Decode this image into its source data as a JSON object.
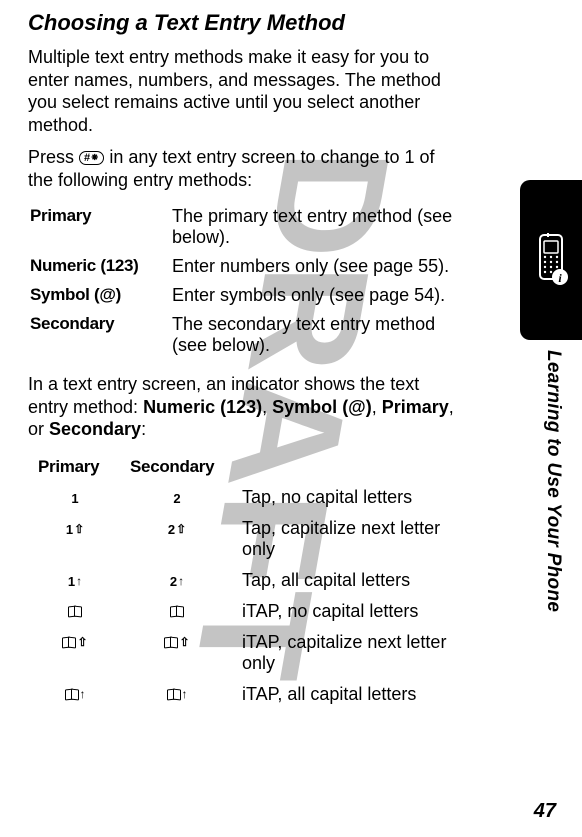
{
  "title": "Choosing a Text Entry Method",
  "intro": "Multiple text entry methods make it easy for you to enter names, numbers, and messages. The method you select remains active until you select another method.",
  "press_pre": "Press ",
  "press_key": "#⁕",
  "press_post": " in any text entry screen to change to 1 of the following entry methods:",
  "methods": [
    {
      "label": "Primary",
      "desc": "The primary text entry method (see below)."
    },
    {
      "label": "Numeric (123)",
      "desc": "Enter numbers only (see page 55)."
    },
    {
      "label": "Symbol (@)",
      "desc": "Enter symbols only (see page 54)."
    },
    {
      "label": "Secondary",
      "desc": "The secondary text entry method (see below)."
    }
  ],
  "indicator_intro_pre": "In a text entry screen, an indicator shows the text entry method: ",
  "indicator_terms": {
    "numeric": "Numeric",
    "numeric_s": "(123)",
    "symbol": "Symbol",
    "symbol_s": "(@)",
    "primary": "Primary",
    "secondary": "Secondary"
  },
  "indicator_table": {
    "header_primary": "Primary",
    "header_secondary": "Secondary",
    "rows": [
      {
        "p": "1",
        "s": "2",
        "desc": "Tap, no capital letters"
      },
      {
        "p": "1⇧",
        "s": "2⇧",
        "desc": "Tap, capitalize next letter only"
      },
      {
        "p": "1↑",
        "s": "2↑",
        "desc": "Tap, all capital letters"
      },
      {
        "p": "book",
        "s": "book",
        "desc": "iTAP, no capital letters"
      },
      {
        "p": "book⇧",
        "s": "book⇧",
        "desc": "iTAP, capitalize next letter only"
      },
      {
        "p": "book↑",
        "s": "book↑",
        "desc": "iTAP, all capital letters"
      }
    ]
  },
  "side_text": "Learning to Use Your Phone",
  "page_num": "47"
}
